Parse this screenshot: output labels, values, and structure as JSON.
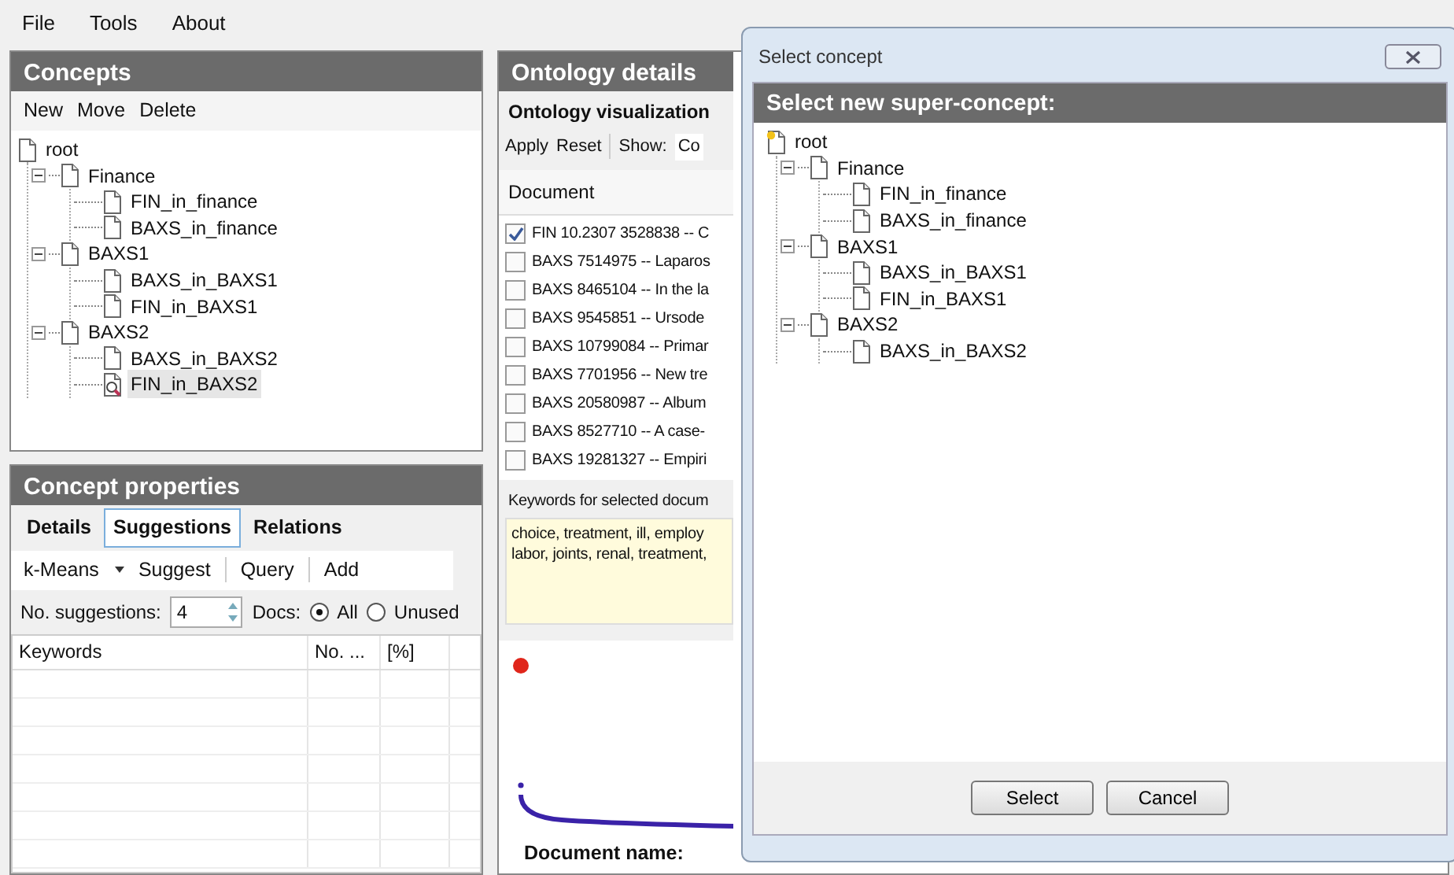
{
  "menu": [
    "File",
    "Tools",
    "About"
  ],
  "concepts": {
    "title": "Concepts",
    "toolbar": [
      "New",
      "Move",
      "Delete"
    ],
    "tree": [
      {
        "label": "root",
        "kind": "page",
        "selected": false,
        "children": [
          {
            "label": "Finance",
            "kind": "page",
            "selected": false,
            "expanded": true,
            "children": [
              {
                "label": "FIN_in_finance",
                "kind": "page",
                "selected": false
              },
              {
                "label": "BAXS_in_finance",
                "kind": "page",
                "selected": false
              }
            ]
          },
          {
            "label": "BAXS1",
            "kind": "page",
            "selected": false,
            "expanded": true,
            "children": [
              {
                "label": "BAXS_in_BAXS1",
                "kind": "page",
                "selected": false
              },
              {
                "label": "FIN_in_BAXS1",
                "kind": "page",
                "selected": false
              }
            ]
          },
          {
            "label": "BAXS2",
            "kind": "page",
            "selected": false,
            "expanded": true,
            "children": [
              {
                "label": "BAXS_in_BAXS2",
                "kind": "page",
                "selected": false
              },
              {
                "label": "FIN_in_BAXS2",
                "kind": "page-search",
                "selected": true
              }
            ]
          }
        ]
      }
    ]
  },
  "concept_properties": {
    "title": "Concept properties",
    "tabs": [
      {
        "label": "Details",
        "selected": false
      },
      {
        "label": "Suggestions",
        "selected": true
      },
      {
        "label": "Relations",
        "selected": false
      }
    ],
    "method": "k-Means",
    "actions": [
      "Suggest",
      "Query",
      "Add"
    ],
    "suggestions_label": "No. suggestions:",
    "suggestions_value": "4",
    "docs_label": "Docs:",
    "docs_options": [
      {
        "label": "All",
        "selected": true
      },
      {
        "label": "Unused",
        "selected": false
      }
    ],
    "table": {
      "columns": [
        "Keywords",
        "No. ...",
        "[%]"
      ]
    }
  },
  "ontology_details": {
    "title": "Ontology details",
    "tab": "Ontology visualization",
    "toolbar": [
      "Apply",
      "Reset"
    ],
    "show_label": "Show:",
    "show_value": "Co",
    "list_header": "Document",
    "documents": [
      {
        "label": "FIN 10.2307 3528838 -- C",
        "checked": true
      },
      {
        "label": "BAXS 7514975 -- Laparos",
        "checked": false
      },
      {
        "label": "BAXS 8465104 -- In the la",
        "checked": false
      },
      {
        "label": "BAXS 9545851 -- Ursode",
        "checked": false
      },
      {
        "label": "BAXS 10799084 -- Primar",
        "checked": false
      },
      {
        "label": "BAXS 7701956 -- New tre",
        "checked": false
      },
      {
        "label": "BAXS 20580987 -- Album",
        "checked": false
      },
      {
        "label": "BAXS 8527710 -- A case-",
        "checked": false
      },
      {
        "label": "BAXS 19281327 -- Empiri",
        "checked": false
      }
    ],
    "keywords_label": "Keywords for selected docum",
    "keywords": [
      "choice, treatment, ill, employ",
      "labor, joints, renal, treatment,"
    ],
    "document_name_label": "Document name:"
  },
  "dialog": {
    "title": "Select concept",
    "heading": "Select new super-concept:",
    "tree": [
      {
        "label": "root",
        "kind": "page-star",
        "children": [
          {
            "label": "Finance",
            "kind": "page",
            "expanded": true,
            "children": [
              {
                "label": "FIN_in_finance",
                "kind": "page"
              },
              {
                "label": "BAXS_in_finance",
                "kind": "page"
              }
            ]
          },
          {
            "label": "BAXS1",
            "kind": "page",
            "expanded": true,
            "children": [
              {
                "label": "BAXS_in_BAXS1",
                "kind": "page"
              },
              {
                "label": "FIN_in_BAXS1",
                "kind": "page"
              }
            ]
          },
          {
            "label": "BAXS2",
            "kind": "page",
            "expanded": true,
            "children": [
              {
                "label": "BAXS_in_BAXS2",
                "kind": "page"
              }
            ]
          }
        ]
      }
    ],
    "buttons": [
      "Select",
      "Cancel"
    ]
  }
}
